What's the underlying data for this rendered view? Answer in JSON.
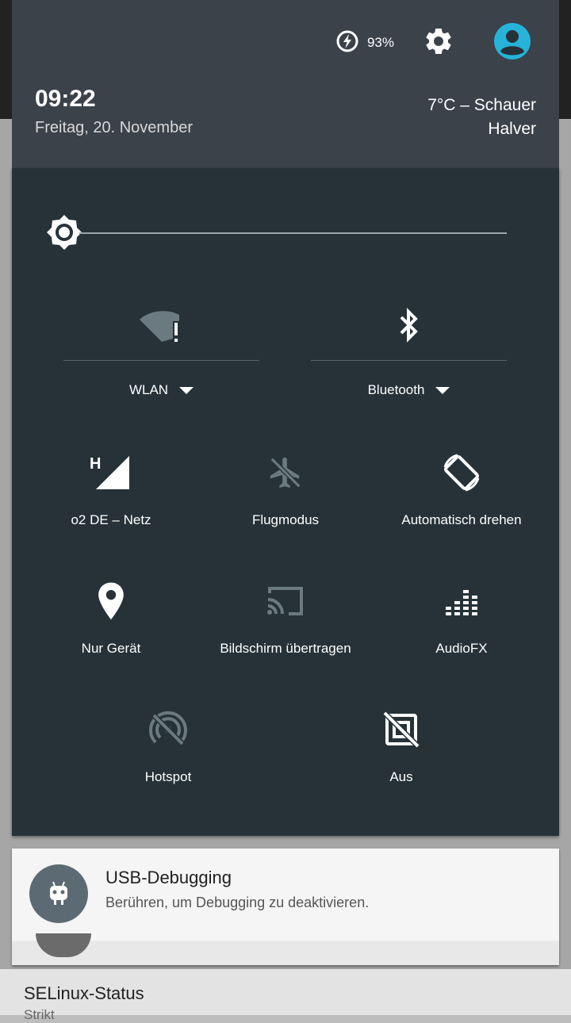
{
  "status": {
    "battery_percent": "93%"
  },
  "header": {
    "time": "09:22",
    "date": "Freitag, 20. November",
    "weather": "7°C – Schauer",
    "location": "Halver"
  },
  "brightness": {
    "level": 0.0
  },
  "big_tiles": [
    {
      "label": "WLAN",
      "icon": "wifi-alert-icon"
    },
    {
      "label": "Bluetooth",
      "icon": "bluetooth-icon"
    }
  ],
  "tiles": [
    {
      "label": "o2 DE – Netz",
      "icon": "cell-signal-icon"
    },
    {
      "label": "Flugmodus",
      "icon": "airplane-icon"
    },
    {
      "label": "Automatisch drehen",
      "icon": "rotate-icon"
    },
    {
      "label": "Nur Gerät",
      "icon": "location-icon"
    },
    {
      "label": "Bildschirm übertragen",
      "icon": "cast-icon"
    },
    {
      "label": "AudioFX",
      "icon": "equalizer-icon"
    },
    {
      "label": "Hotspot",
      "icon": "hotspot-off-icon"
    },
    {
      "label": "Aus",
      "icon": "nfc-off-icon"
    }
  ],
  "notification": {
    "title": "USB-Debugging",
    "text": "Berühren, um Debugging zu deaktivieren.",
    "icon": "android-debug-icon"
  },
  "next_notification": {
    "title": "SELinux-Status",
    "text": "Strikt"
  },
  "colors": {
    "panel": "#263238",
    "header": "#3b424a",
    "accent": "#26b3d9",
    "disabled": "#6b7a80"
  }
}
